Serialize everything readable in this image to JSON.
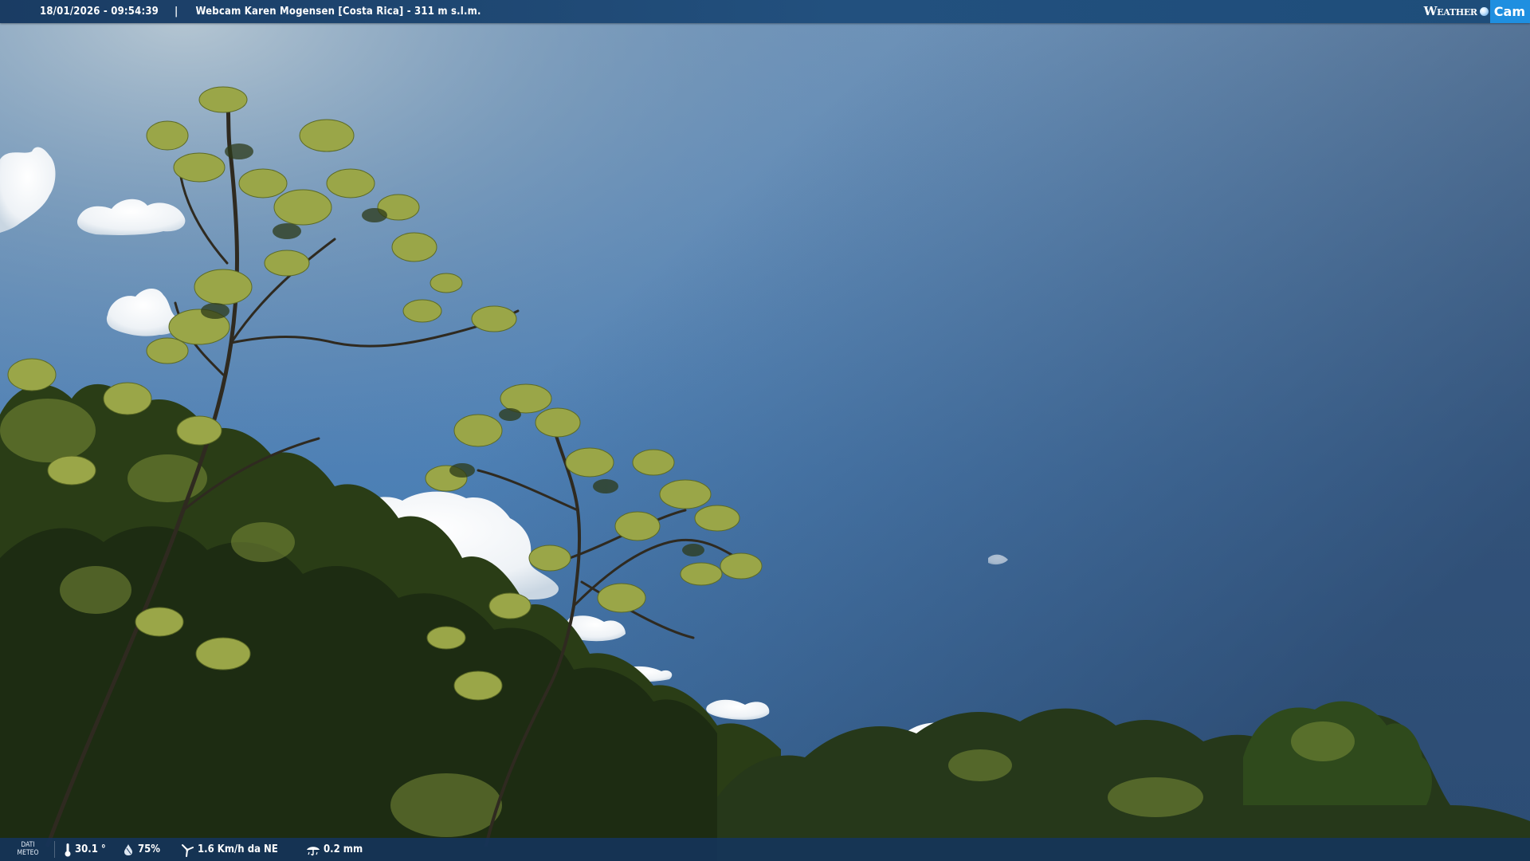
{
  "header": {
    "datetime": "18/01/2026 - 09:54:39",
    "separator": "|",
    "title": "Webcam Karen Mogensen [Costa Rica] - 311 m s.l.m."
  },
  "logo": {
    "weather_text": "Weather",
    "cam_text": "Cam",
    "brand_color": "#1f8fe0"
  },
  "weather_bar": {
    "label": "DATI METEO",
    "temperature": "30.1 °",
    "humidity": "75%",
    "wind": "1.6 Km/h da NE",
    "rain": "0.2 mm",
    "icons": [
      "thermometer-icon",
      "humidity-drop-icon",
      "wind-icon",
      "rain-icon"
    ]
  },
  "colors": {
    "sky_top_left": "#93adc3",
    "sky_top_right": "#2e4a6e",
    "sky_bottom": "#4b7fb4",
    "foliage_dark": "#1d2d12",
    "foliage_light": "#8a9a3a",
    "bar_background": "#14345c"
  }
}
